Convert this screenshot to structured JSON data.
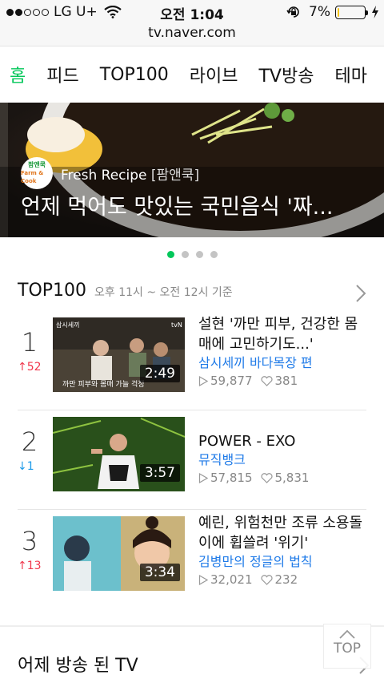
{
  "status_bar": {
    "carrier": "LG U+",
    "time": "오전 1:04",
    "battery": "7%",
    "battery_level": 0.07,
    "signal_bars": 2
  },
  "url": "tv.naver.com",
  "tabs": [
    {
      "label": "홈",
      "active": true
    },
    {
      "label": "피드"
    },
    {
      "label": "TOP100"
    },
    {
      "label": "라이브"
    },
    {
      "label": "TV방송"
    },
    {
      "label": "테마"
    }
  ],
  "hero": {
    "channel": "Fresh Recipe",
    "channel_sub": "[팜앤쿡]",
    "logo_line1": "팜앤쿡",
    "logo_line2": "Farm & Cook",
    "title": "언제 먹어도 맛있는 국민음식 '짜...",
    "pager_count": 4,
    "pager_active": 0
  },
  "top100": {
    "title": "TOP100",
    "subtitle": "오후 11시 ~ 오전 12시 기준",
    "items": [
      {
        "rank": "1",
        "delta": "↑52",
        "delta_dir": "up",
        "duration": "2:49",
        "title": "설현 '까만 피부, 건강한 몸매에 고민하기도...'",
        "program": "삼시세끼 바다목장 편",
        "views": "59,877",
        "likes": "381",
        "thumb_caption": "까만 피부와 몸매 가늘 걱정",
        "thumb_logo": "tvN"
      },
      {
        "rank": "2",
        "delta": "↓1",
        "delta_dir": "down",
        "duration": "3:57",
        "title": "POWER - EXO",
        "program": "뮤직뱅크",
        "views": "57,815",
        "likes": "5,831"
      },
      {
        "rank": "3",
        "delta": "↑13",
        "delta_dir": "up",
        "duration": "3:34",
        "title": "예린, 위험천만 조류 소용돌이에 휩쓸려 '위기'",
        "program": "김병만의 정글의 법칙",
        "views": "32,021",
        "likes": "232"
      }
    ]
  },
  "section2": {
    "title": "어제 방송 된 TV"
  },
  "top_button": "TOP",
  "colors": {
    "accent": "#03c75a",
    "link": "#1e7ae8",
    "up": "#f0384d",
    "down": "#1e9be9"
  }
}
